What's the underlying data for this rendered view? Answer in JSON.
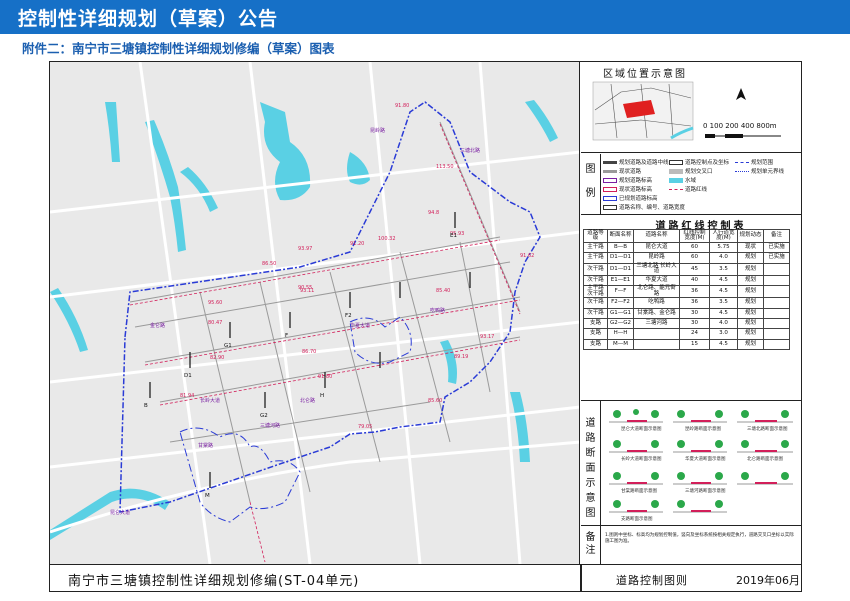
{
  "header": {
    "title": "控制性详细规划（草案）公告",
    "subtitle": "附件二：南宁市三塘镇控制性详细规划修编（草案）图表"
  },
  "footer": {
    "plan_title": "南宁市三塘镇控制性详细规划修编(ST-04单元)",
    "sheet_name": "道路控制图则",
    "date": "2019年06月"
  },
  "colors": {
    "header_bg": "#1670c7",
    "river": "#5ad0e4",
    "plan_boundary": "#2a3bd6",
    "road_line": "#9a9a9a",
    "road_name": "#7a1fa2",
    "redline": "#d21f5a",
    "land_fill": "#e9e9e9"
  },
  "location_map": {
    "title": "区域位置示意图",
    "scale": "0 100 200   400        800m"
  },
  "legend": {
    "label": "图例",
    "items": [
      "规划道路及道路中线",
      "现状道路",
      "规划道路标高",
      "现状道路标高",
      "已规划道路标高",
      "道路控制点及坐标",
      "规划交叉口",
      "水域",
      "道路红线",
      "规划范围",
      "规划单元界线",
      "道路名称、编号、道路宽度"
    ]
  },
  "road_table": {
    "title": "道路红线控制表",
    "headers": [
      "道路等级",
      "断面名称",
      "道路名称",
      "红线控制宽度(M)",
      "人行道宽度(M)",
      "规划动态",
      "备注"
    ],
    "rows": [
      [
        "主干路",
        "B—B",
        "昆仑大道",
        "60",
        "5.75",
        "现状",
        "已实施"
      ],
      [
        "主干路",
        "D1—D1",
        "昆岭路",
        "60",
        "4.0",
        "规划",
        "已实施"
      ],
      [
        "次干路",
        "D1—D1",
        "三塘北路 长岭大道",
        "45",
        "3.5",
        "规划",
        ""
      ],
      [
        "次干路",
        "E1—E1",
        "华夏大道",
        "40",
        "4.5",
        "规划",
        ""
      ],
      [
        "主干路 次干路",
        "F—F",
        "北仑路、能元街路",
        "36",
        "4.5",
        "规划",
        ""
      ],
      [
        "次干路",
        "F2—F2",
        "吃鸭路",
        "36",
        "3.5",
        "规划",
        ""
      ],
      [
        "次干路",
        "G1—G1",
        "甘棠路、金仑路",
        "30",
        "4.5",
        "规划",
        ""
      ],
      [
        "支路",
        "G2—G2",
        "三塘河路",
        "30",
        "4.0",
        "规划",
        ""
      ],
      [
        "支路",
        "H—H",
        "",
        "24",
        "3.0",
        "规划",
        ""
      ],
      [
        "支路",
        "M—M",
        "",
        "15",
        "4.5",
        "规划",
        ""
      ]
    ]
  },
  "sections": {
    "label": "道路断面示意图",
    "captions": [
      "昆仑大道断面示意图",
      "昆岭路断面示意图",
      "三塘北路断面示意图",
      "长岭大道断面示意图",
      "华夏大道断面示意图",
      "北仑路断面示意图",
      "甘棠路断面示意图",
      "三塘河路断面示意图",
      "支路断面示意图"
    ]
  },
  "notes": {
    "label": "备注",
    "text": "1.图则中坐标、标高均为规划控制值，竖向及坐标系统按相关规定执行，道路交叉口坐标以实际施工图为准。"
  },
  "map_labels": {
    "elevations": [
      "91.80",
      "100.32",
      "95.93",
      "93.97",
      "91.20",
      "86.50",
      "95.60",
      "91.62",
      "90.55",
      "93.17",
      "80.47",
      "85.40",
      "82.90",
      "89.19",
      "91.80",
      "85.60",
      "81.94",
      "113.50",
      "94.8",
      "93.11",
      "86.70",
      "79.05"
    ],
    "road_names": [
      "华夏大道",
      "昆仑大道",
      "三塘北路",
      "长岭大道",
      "甘棠路",
      "金仑路",
      "北仑路",
      "吃鸭路",
      "三塘河路",
      "昆岭路"
    ],
    "section_marks": [
      "B",
      "D1",
      "E1",
      "F",
      "F2",
      "G1",
      "G2",
      "H",
      "M"
    ]
  }
}
